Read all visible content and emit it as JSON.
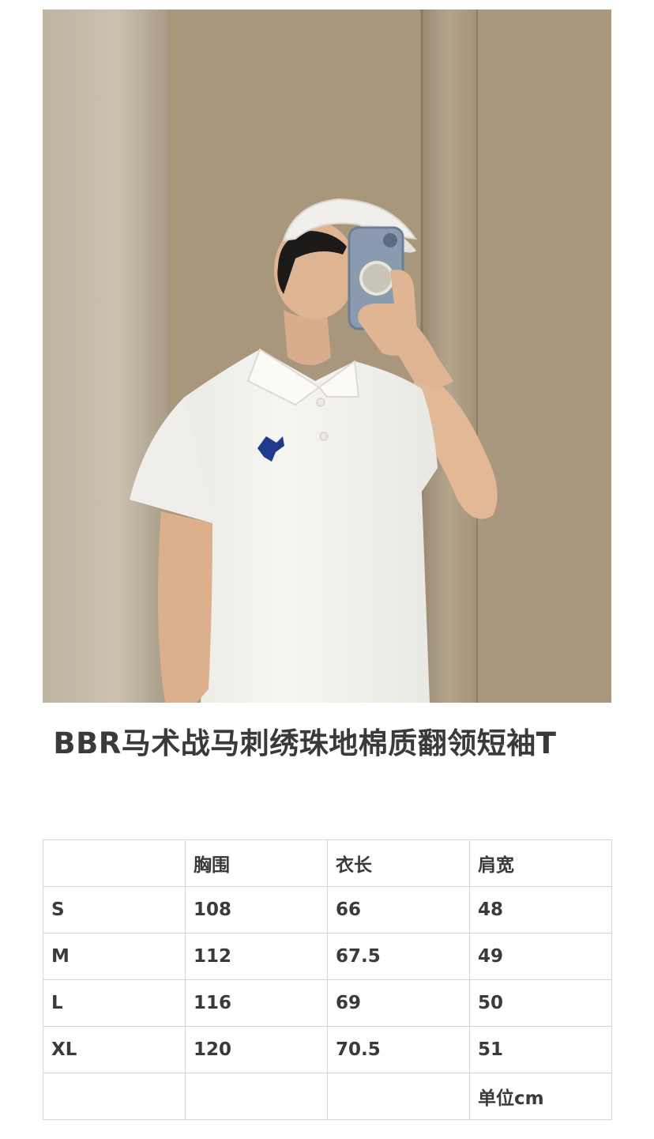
{
  "product": {
    "title": " BBR马术战马刺绣珠地棉质翻领短袖T"
  },
  "size_table": {
    "headers": [
      "",
      "胸围",
      "衣长",
      "肩宽"
    ],
    "rows": [
      [
        "S",
        "108",
        "66",
        "48"
      ],
      [
        "M",
        "112",
        "67.5",
        "49"
      ],
      [
        "L",
        "116",
        "69",
        "50"
      ],
      [
        "XL",
        "120",
        "70.5",
        "51"
      ]
    ],
    "unit_note": "单位cm"
  },
  "colors": {
    "wall": "#b09f88",
    "shirt": "#f3f2ee",
    "logo": "#1f3a8a",
    "cap": "#f0efeb"
  }
}
